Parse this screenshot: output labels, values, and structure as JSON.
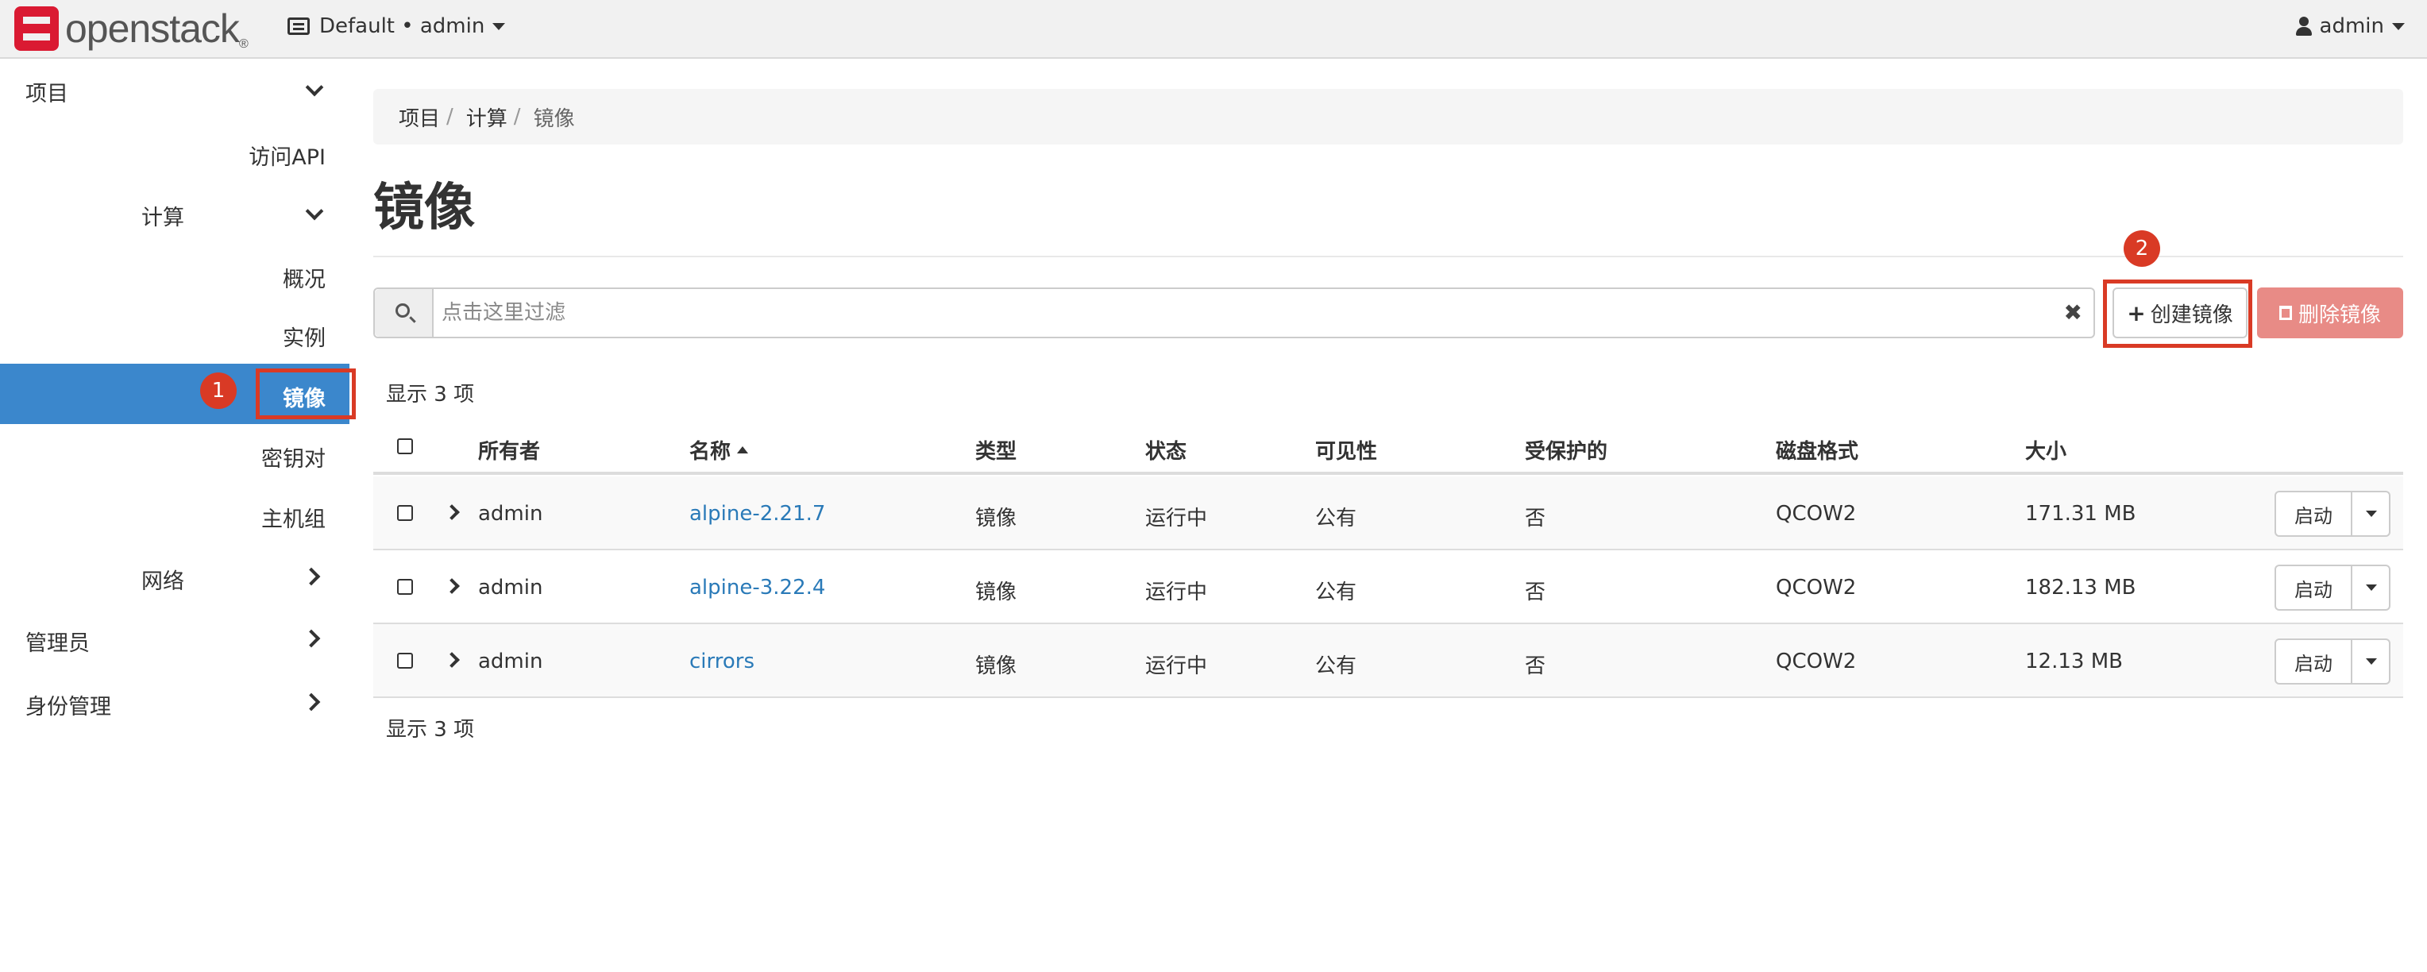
{
  "navbar": {
    "brand": "openstack",
    "brand_mark": "®",
    "project_switcher": "Default • admin",
    "user": "admin"
  },
  "sidebar": {
    "project": "项目",
    "api_access": "访问API",
    "compute": "计算",
    "overview": "概况",
    "instances": "实例",
    "images": "镜像",
    "key_pairs": "密钥对",
    "server_groups": "主机组",
    "network": "网络",
    "admin": "管理员",
    "identity": "身份管理"
  },
  "breadcrumb": {
    "items": [
      "项目",
      "计算",
      "镜像"
    ],
    "separator": "/"
  },
  "page": {
    "title": "镜像"
  },
  "filter": {
    "placeholder": "点击这里过滤",
    "value": ""
  },
  "toolbar": {
    "create_label": "创建镜像",
    "delete_label": "删除镜像"
  },
  "summary": {
    "top": "显示 3 项",
    "bottom": "显示 3 项"
  },
  "table": {
    "headers": {
      "owner": "所有者",
      "name": "名称",
      "type": "类型",
      "status": "状态",
      "visibility": "可见性",
      "protected": "受保护的",
      "disk_format": "磁盘格式",
      "size": "大小"
    },
    "rows": [
      {
        "owner": "admin",
        "name": "alpine-2.21.7",
        "type": "镜像",
        "status": "运行中",
        "visibility": "公有",
        "protected": "否",
        "disk_format": "QCOW2",
        "size": "171.31 MB",
        "action": "启动"
      },
      {
        "owner": "admin",
        "name": "alpine-3.22.4",
        "type": "镜像",
        "status": "运行中",
        "visibility": "公有",
        "protected": "否",
        "disk_format": "QCOW2",
        "size": "182.13 MB",
        "action": "启动"
      },
      {
        "owner": "admin",
        "name": "cirrors",
        "type": "镜像",
        "status": "运行中",
        "visibility": "公有",
        "protected": "否",
        "disk_format": "QCOW2",
        "size": "12.13 MB",
        "action": "启动"
      }
    ]
  },
  "annotations": {
    "badge_1": "1",
    "badge_2": "2"
  },
  "colors": {
    "accent": "#3b87cc",
    "link": "#2a7ab8",
    "danger_button": "#e88b86",
    "annotation": "#d93a25",
    "brand": "#da1a32"
  }
}
